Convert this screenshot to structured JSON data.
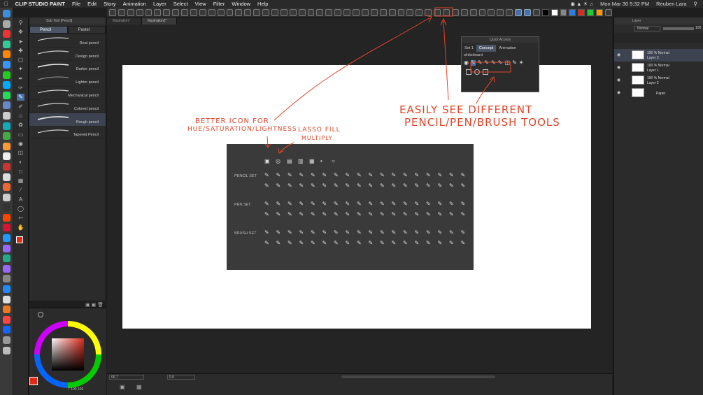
{
  "menubar": {
    "app_name": "CLIP STUDIO PAINT",
    "items": [
      "File",
      "Edit",
      "Story",
      "Animation",
      "Layer",
      "Select",
      "View",
      "Filter",
      "Window",
      "Help"
    ],
    "datetime": "Mon Mar 30  5:32 PM",
    "user": "Reuben Lara"
  },
  "subtool": {
    "header": "Sub Tool [Pencil]",
    "tabs": [
      "Pencil",
      "Pastel"
    ],
    "brushes": [
      "Real pencil",
      "Design pencil",
      "Darker pencil",
      "Lighter pencil",
      "Mechanical pencil",
      "Colored pencil",
      "Rough pencil",
      "Tapered Pencil"
    ],
    "selected_brush": "Rough pencil"
  },
  "doc_tabs": [
    "Illustration*",
    "Illustration2*"
  ],
  "quick_access": {
    "title": "Quick Access",
    "tabs": [
      "Set 1",
      "Concept",
      "Animation"
    ],
    "active_tab": "Concept",
    "section": "whiteboard"
  },
  "layers": {
    "panel_title": "Layer",
    "blend_mode": "Normal",
    "opacity": "100",
    "rows": [
      {
        "mode": "100 % Normal",
        "name": "Layer 3"
      },
      {
        "mode": "100 % Normal",
        "name": "Layer 1"
      },
      {
        "mode": "100 % Normal",
        "name": "Layer 2"
      },
      {
        "mode": "",
        "name": "Paper"
      }
    ]
  },
  "mockup": {
    "sets": [
      "PENCIL SET",
      "PEN SET",
      "BRUSH SET"
    ]
  },
  "annotations": {
    "better_icon": [
      "BETTER ICON FOR",
      "HUE/SATURATION/LIGHTNESS"
    ],
    "lasso": [
      "LASSO FILL",
      "MULTIPLY"
    ],
    "easily": [
      "EASILY SEE DIFFERENT",
      "PENCIL/PEN/BRUSH TOOLS"
    ]
  },
  "status": {
    "zoom": "66.7",
    "rotation": "0.0",
    "color_values": "7 100 100"
  },
  "colors": {
    "accent": "#4a6ea8",
    "annotation": "#e0462a",
    "main_color": "#e02a1a"
  }
}
